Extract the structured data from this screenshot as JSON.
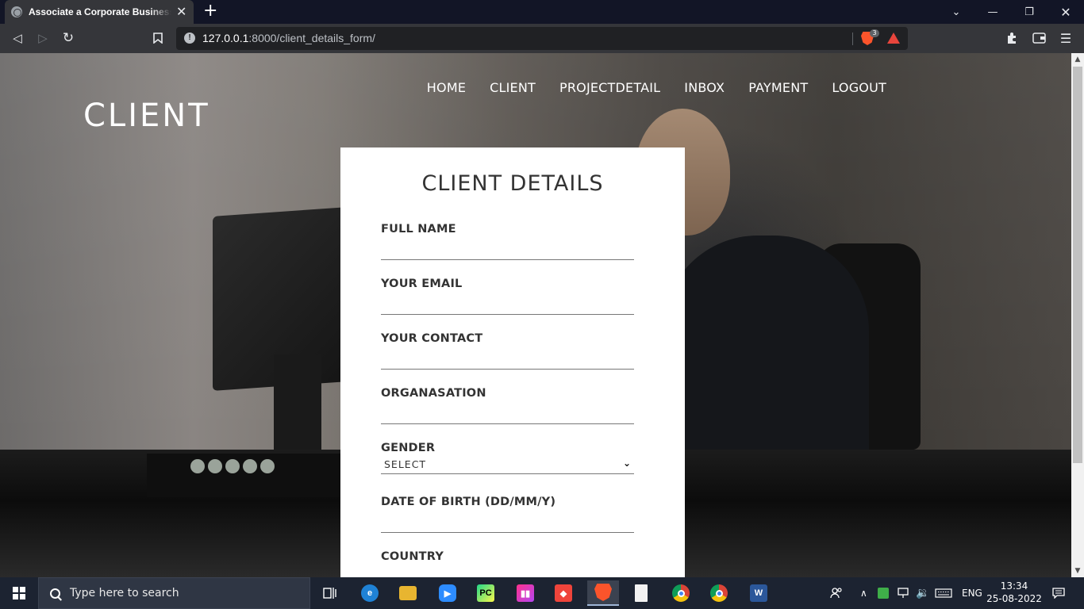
{
  "browser": {
    "tab_title": "Associate a Corporate Business Client",
    "url_host": "127.0.0.1",
    "url_rest": ":8000/client_details_form/",
    "brave_badge": "3"
  },
  "site": {
    "brand": "CLIENT",
    "nav": [
      "HOME",
      "CLIENT",
      "PROJECTDETAIL",
      "INBOX",
      "PAYMENT",
      "LOGOUT"
    ]
  },
  "form": {
    "title": "CLIENT DETAILS",
    "fields": {
      "full_name": "FULL NAME",
      "email": "YOUR EMAIL",
      "contact": "YOUR CONTACT",
      "organisation": "ORGANASATION",
      "gender": "GENDER",
      "dob": "DATE OF BIRTH (DD/MM/Y)",
      "country": "COUNTRY"
    },
    "gender_selected": "SELECT"
  },
  "taskbar": {
    "search_placeholder": "Type here to search",
    "language": "ENG",
    "time": "13:34",
    "date": "25-08-2022"
  },
  "colors": {
    "browser_tabbar": "#121526",
    "browser_toolbar": "#35363a",
    "taskbar": "#1c2331",
    "card_bg": "#ffffff"
  }
}
